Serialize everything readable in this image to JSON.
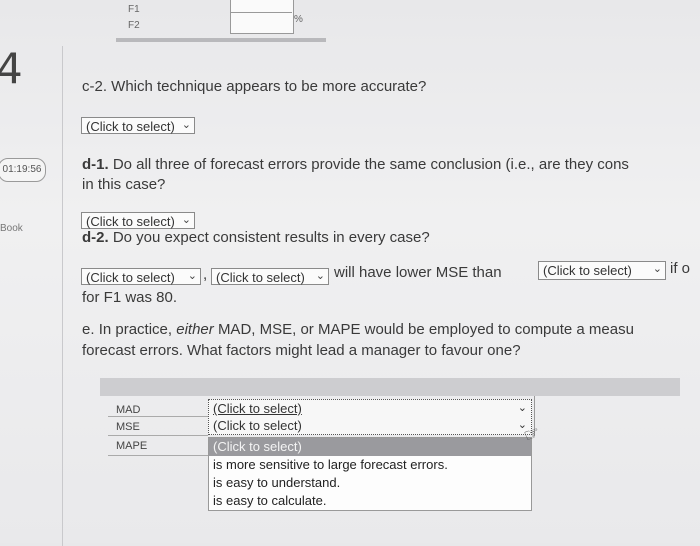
{
  "top": {
    "f1": "F1",
    "f2": "F2",
    "pct1": "%",
    "pct2": "%"
  },
  "question_number": "4",
  "timer": "01:19:56",
  "book_label": "Book",
  "c2": {
    "question": "c-2. Which technique appears to be more accurate?",
    "select": "(Click to select)"
  },
  "d1": {
    "label": "d-1.",
    "question_line1": "Do all three of forecast errors provide the same conclusion (i.e., are they cons",
    "question_line2": "in this case?",
    "select": "(Click to select)"
  },
  "d2": {
    "label": "d-2.",
    "question": "Do you expect consistent results in every case?",
    "select1": "(Click to select)",
    "comma": ",",
    "select2": "(Click to select)",
    "mid_text": "will have lower MSE than",
    "select3": "(Click to select)",
    "trail": "if o",
    "line2": "for F1 was 80."
  },
  "e": {
    "label": "e.",
    "line1_a": "In practice,",
    "line1_b": "either",
    "line1_c": "MAD, MSE, or MAPE would be employed to compute a measu",
    "line2": "forecast errors. What factors might lead a manager to favour one?"
  },
  "table": {
    "rows": [
      "MAD",
      "MSE",
      "MAPE"
    ],
    "dropdown_mad": "(Click to select)",
    "dropdown_mse": "(Click to select)",
    "options": [
      "(Click to select)",
      "is more sensitive to large forecast errors.",
      "is easy to understand.",
      "is easy to calculate."
    ]
  }
}
